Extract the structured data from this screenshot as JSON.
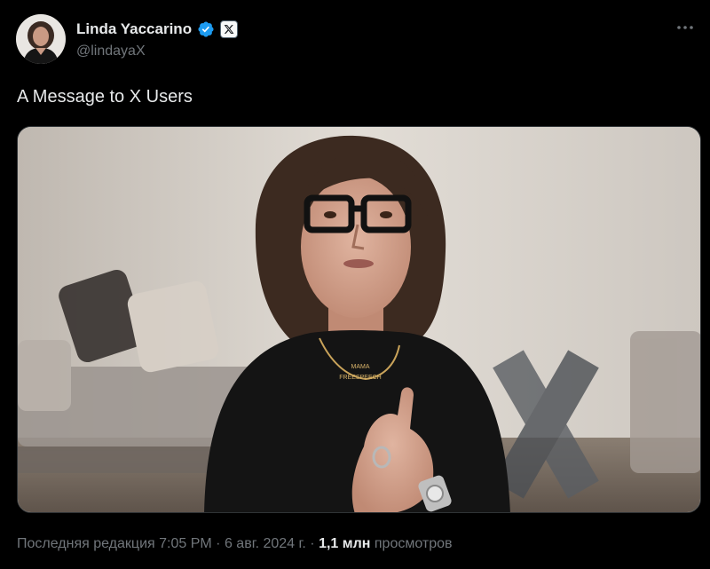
{
  "author": {
    "display_name": "Linda Yaccarino",
    "handle": "@lindayaX",
    "verified_color": "#1d9bf0",
    "avatar_icon": "profile-photo",
    "affiliation_icon": "x-logo-icon"
  },
  "tweet": {
    "text": "A Message to X Users",
    "media_icon": "video-thumbnail",
    "media_captions": {
      "necklace_line1": "MAMA",
      "necklace_line2": "FREESPEECH"
    }
  },
  "meta": {
    "edited_label": "Последняя редакция",
    "time": "7:05 PM",
    "separator": "·",
    "date": "6 авг. 2024 г.",
    "views_count": "1,1 млн",
    "views_label": "просмотров"
  },
  "menu": {
    "more_icon": "more-horizontal-icon"
  }
}
